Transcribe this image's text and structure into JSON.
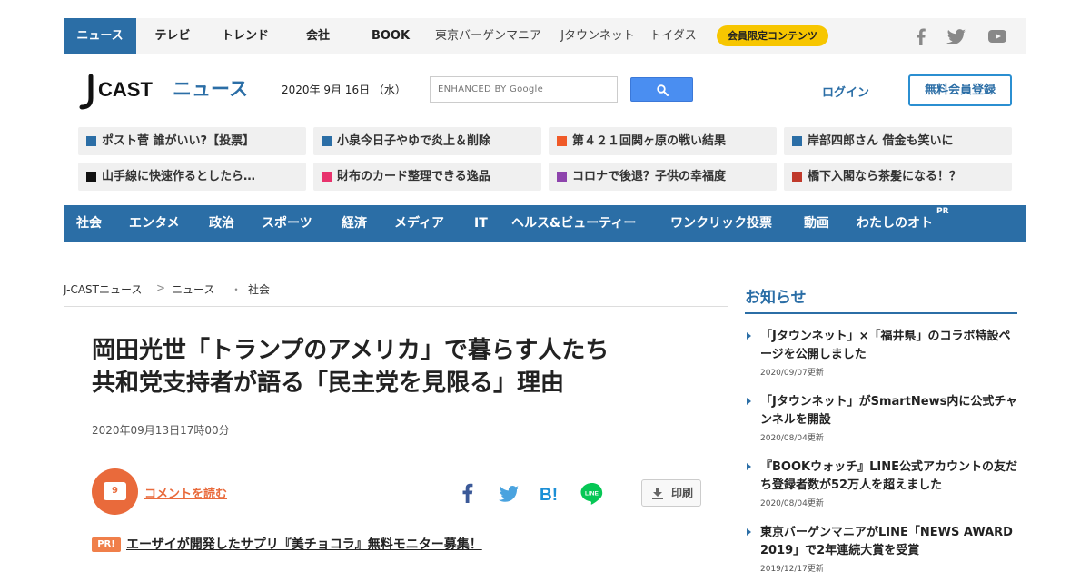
{
  "topnav": {
    "items": [
      "ニュース",
      "テレビ",
      "トレンド",
      "会社",
      "BOOK",
      "東京バーゲンマニア",
      "Jタウンネット",
      "トイダス"
    ],
    "member_badge": "会員限定コンテンツ",
    "social_icons": [
      "facebook-icon",
      "twitter-icon",
      "youtube-icon"
    ]
  },
  "header": {
    "logo_j": "J",
    "logo_cast": "CAST",
    "logo_news": "ニュース",
    "date": "2020年 9月 16日 （水）",
    "search_placeholder": "ENHANCED BY Google",
    "login": "ログイン",
    "register": "無料会員登録"
  },
  "tiles": [
    {
      "label": "ポスト菅 誰がいい?【投票】",
      "color": "#2b6ea6"
    },
    {
      "label": "小泉今日子やゆで炎上＆削除",
      "color": "#2b6ea6"
    },
    {
      "label": "第４２１回関ヶ原の戦い結果",
      "color": "#f05a28"
    },
    {
      "label": "岸部四郎さん 借金も笑いに",
      "color": "#2b6ea6"
    },
    {
      "label": "山手線に快速作るとしたら…",
      "color": "#111111"
    },
    {
      "label": "財布のカード整理できる逸品",
      "color": "#e8336d"
    },
    {
      "label": "コロナで後退？子供の幸福度",
      "color": "#8e44ad"
    },
    {
      "label": "橋下入閣なら茶髪になる！？",
      "color": "#c0392b"
    }
  ],
  "categories": [
    "社会",
    "エンタメ",
    "政治",
    "スポーツ",
    "経済",
    "メディア",
    "IT",
    "ヘルス&ビューティー",
    "ワンクリック投票",
    "動画",
    "わたしのオト"
  ],
  "category_pr": "PR",
  "breadcrumb": [
    "J-CASTニュース",
    ">",
    "ニュース",
    "・",
    "社会"
  ],
  "article": {
    "title_line1": "岡田光世「トランプのアメリカ」で暮らす人たち",
    "title_line2": "共和党支持者が語る「民主党を見限る」理由",
    "date": "2020年09月13日17時00分",
    "comment_count": "9",
    "comment_link": "コメントを読む",
    "print": "印刷",
    "pr_badge": "PR!",
    "pr_link": "エーザイが開発したサプリ『美チョコラ』無料モニター募集！"
  },
  "sidebar": {
    "title": "お知らせ",
    "notices": [
      {
        "text": "「Jタウンネット」×「福井県」のコラボ特設ページを公開しました",
        "date": "2020/09/07更新"
      },
      {
        "text": "「Jタウンネット」がSmartNews内に公式チャンネルを開設",
        "date": "2020/08/04更新"
      },
      {
        "text": "『BOOKウォッチ』LINE公式アカウントの友だち登録者数が52万人を超えました",
        "date": "2020/08/04更新"
      },
      {
        "text": "東京バーゲンマニアがLINE「NEWS AWARD 2019」で2年連続大賞を受賞",
        "date": "2019/12/17更新"
      }
    ]
  },
  "colors": {
    "brand": "#2b6ea6",
    "accent": "#e96a3b",
    "badge": "#f7c600"
  }
}
